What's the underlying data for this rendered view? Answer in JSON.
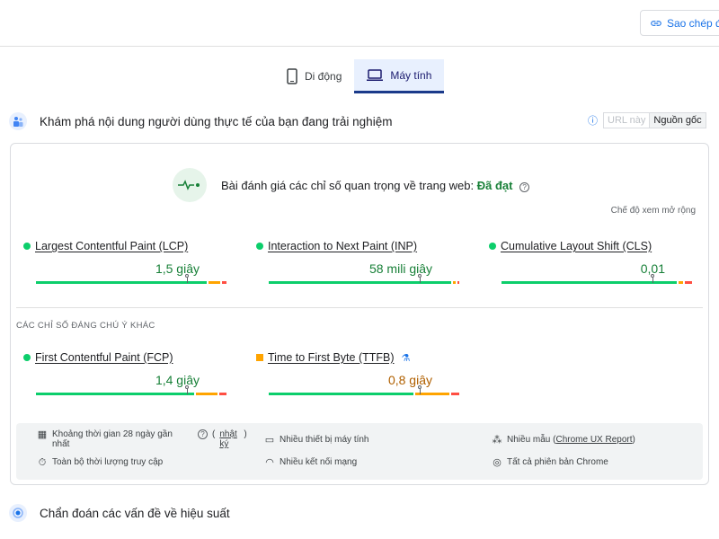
{
  "header": {
    "copy_link_label": "Sao chép đư"
  },
  "tabs": [
    {
      "label": "Di động",
      "active": false
    },
    {
      "label": "Máy tính",
      "active": true
    }
  ],
  "field_section": {
    "title": "Khám phá nội dung người dùng thực tế của bạn đang trải nghiệm",
    "toggle": {
      "url_label": "URL này",
      "origin_label": "Nguồn gốc",
      "selected": "Nguồn gốc"
    }
  },
  "assessment": {
    "text": "Bài đánh giá các chỉ số quan trọng về trang web:",
    "result": "Đã đạt",
    "expand_label": "Chế độ xem mở rộng"
  },
  "core_metrics": [
    {
      "name": "Largest Contentful Paint (LCP)",
      "value": "1,5 giây",
      "status": "good"
    },
    {
      "name": "Interaction to Next Paint (INP)",
      "value": "58 mili giây",
      "status": "good"
    },
    {
      "name": "Cumulative Layout Shift (CLS)",
      "value": "0,01",
      "status": "good"
    }
  ],
  "other_metrics_heading": "CÁC CHỈ SỐ ĐÁNG CHÚ Ý KHÁC",
  "other_metrics": [
    {
      "name": "First Contentful Paint (FCP)",
      "value": "1,4 giây",
      "status": "good"
    },
    {
      "name": "Time to First Byte (TTFB)",
      "value": "0,8 giây",
      "status": "average"
    }
  ],
  "footer": {
    "period_label": "Khoảng thời gian 28 ngày gần nhất",
    "log_link": "nhật ký",
    "device_label": "Nhiều thiết bị máy tính",
    "samples_label": "Nhiều mẫu",
    "crux_link": "Chrome UX Report",
    "duration_label": "Toàn bộ thời lượng truy cập",
    "network_label": "Nhiều kết nối mạng",
    "chrome_label": "Tất cả phiên bản Chrome"
  },
  "diagnose_section": {
    "title": "Chẩn đoán các vấn đề về hiệu suất"
  },
  "colors": {
    "good": "#0cce6b",
    "average": "#ffa400",
    "poor": "#ff4e42",
    "accent": "#1a73e8"
  },
  "icons": [
    "link-icon",
    "phone-icon",
    "laptop-icon",
    "people-icon",
    "info-icon",
    "pulse-icon",
    "help-icon",
    "flask-icon",
    "calendar-icon",
    "timer-icon",
    "monitor-icon",
    "wifi-icon",
    "samples-icon",
    "chrome-icon",
    "diagnose-icon"
  ]
}
